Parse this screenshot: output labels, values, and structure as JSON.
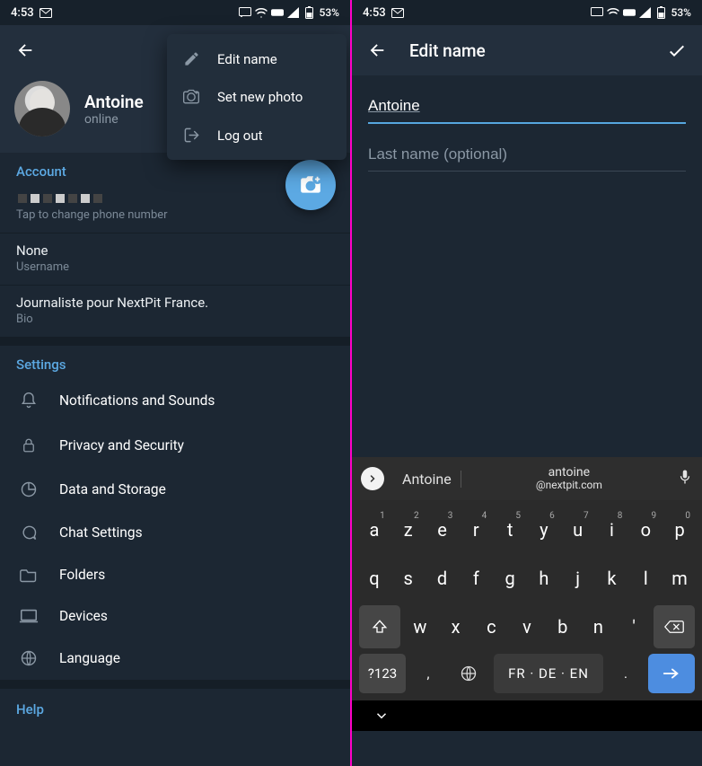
{
  "status": {
    "time": "4:53",
    "battery": "53%"
  },
  "left": {
    "profile": {
      "name": "Antoine",
      "status": "online"
    },
    "popup": {
      "edit": "Edit name",
      "photo": "Set new photo",
      "logout": "Log out"
    },
    "account": {
      "header": "Account",
      "phone_sub": "Tap to change phone number",
      "username_val": "None",
      "username_sub": "Username",
      "bio_val": "Journaliste pour NextPit France.",
      "bio_sub": "Bio"
    },
    "settings": {
      "header": "Settings",
      "items": [
        "Notifications and Sounds",
        "Privacy and Security",
        "Data and Storage",
        "Chat Settings",
        "Folders",
        "Devices",
        "Language"
      ]
    },
    "help": {
      "header": "Help"
    }
  },
  "right": {
    "title": "Edit name",
    "first_name": "Antoine",
    "last_name_placeholder": "Last name (optional)",
    "keyboard": {
      "suggestion_main": "Antoine",
      "suggestion_sec_top": "antoine",
      "suggestion_sec_bottom": "@nextpit.com",
      "row1": [
        "a",
        "z",
        "e",
        "r",
        "t",
        "y",
        "u",
        "i",
        "o",
        "p"
      ],
      "row1_nums": [
        "1",
        "2",
        "3",
        "4",
        "5",
        "6",
        "7",
        "8",
        "9",
        "0"
      ],
      "row2": [
        "q",
        "s",
        "d",
        "f",
        "g",
        "h",
        "j",
        "k",
        "l",
        "m"
      ],
      "row3": [
        "w",
        "x",
        "c",
        "v",
        "b",
        "n",
        "'"
      ],
      "sym": "?123",
      "space": "FR · DE · EN"
    }
  }
}
